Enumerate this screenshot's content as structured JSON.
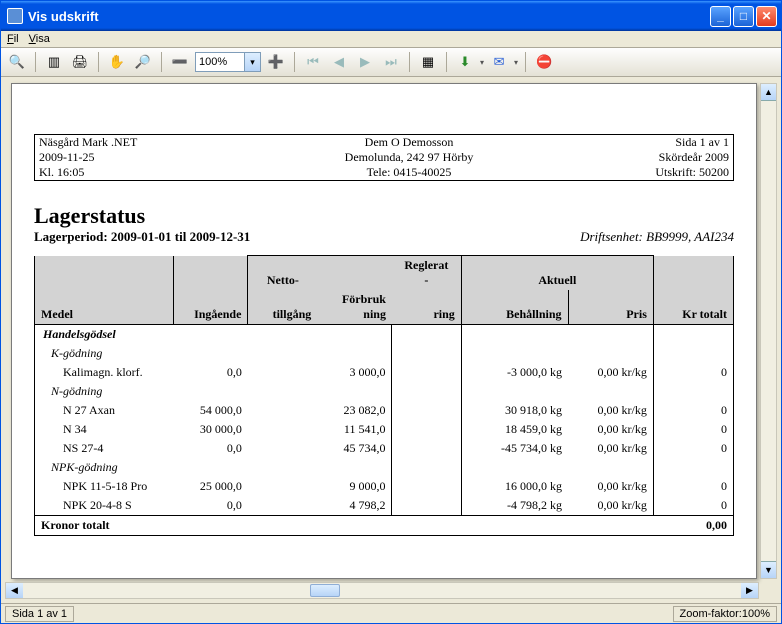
{
  "window": {
    "title": "Vis udskrift"
  },
  "menu": {
    "file": "Fil",
    "view": "Visa"
  },
  "toolbar": {
    "zoom_value": "100%",
    "icons": [
      "binoculars",
      "page-thumb",
      "print",
      "hand",
      "zoom",
      "zoom-out",
      "zoom-in",
      "nav-first",
      "nav-prev",
      "nav-next",
      "nav-last",
      "cols",
      "export",
      "mail",
      "close"
    ]
  },
  "report": {
    "header": {
      "app": "Näsgård Mark .NET",
      "company": "Dem O Demosson",
      "page": "Sida 1 av 1",
      "date": "2009-11-25",
      "address": "Demolunda, 242 97 Hörby",
      "year": "Skördeår 2009",
      "time": "Kl. 16:05",
      "tele": "Tele: 0415-40025",
      "print": "Utskrift: 50200"
    },
    "title": "Lagerstatus",
    "period": "Lagerperiod: 2009-01-01 til 2009-12-31",
    "unit": "Driftsenhet: BB9999, AAI234",
    "columns": {
      "medel": "Medel",
      "ingaende": "Ingående",
      "netto_top": "Netto-",
      "netto_bot": "tillgång",
      "forbruk": "Förbruk\nning",
      "reglerat_top": "Reglerat",
      "reglerat_mid": "-",
      "reglerat_bot": "ring",
      "aktuell": "Aktuell",
      "behallning": "Behållning",
      "pris": "Pris",
      "krtotalt": "Kr totalt"
    },
    "groups": [
      {
        "category": "Handelsgödsel",
        "subgroups": [
          {
            "name": "K-gödning",
            "rows": [
              {
                "name": "Kalimagn. klorf.",
                "ing": "0,0",
                "for": "3 000,0",
                "beh": "-3 000,0 kg",
                "pris": "0,00  kr/kg",
                "tot": "0"
              }
            ]
          },
          {
            "name": "N-gödning",
            "rows": [
              {
                "name": "N 27 Axan",
                "ing": "54 000,0",
                "for": "23 082,0",
                "beh": "30 918,0 kg",
                "pris": "0,00  kr/kg",
                "tot": "0"
              },
              {
                "name": "N 34",
                "ing": "30 000,0",
                "for": "11 541,0",
                "beh": "18 459,0 kg",
                "pris": "0,00  kr/kg",
                "tot": "0"
              },
              {
                "name": "NS 27-4",
                "ing": "0,0",
                "for": "45 734,0",
                "beh": "-45 734,0 kg",
                "pris": "0,00  kr/kg",
                "tot": "0"
              }
            ]
          },
          {
            "name": "NPK-gödning",
            "rows": [
              {
                "name": "NPK 11-5-18 Pro",
                "ing": "25 000,0",
                "for": "9 000,0",
                "beh": "16 000,0 kg",
                "pris": "0,00  kr/kg",
                "tot": "0"
              },
              {
                "name": "NPK 20-4-8 S",
                "ing": "0,0",
                "for": "4 798,2",
                "beh": "-4 798,2 kg",
                "pris": "0,00  kr/kg",
                "tot": "0"
              }
            ]
          }
        ]
      }
    ],
    "footer": {
      "label": "Kronor totalt",
      "value": "0,00"
    }
  },
  "status": {
    "page": "Sida 1 av 1",
    "zoom": "Zoom-faktor:100%"
  }
}
